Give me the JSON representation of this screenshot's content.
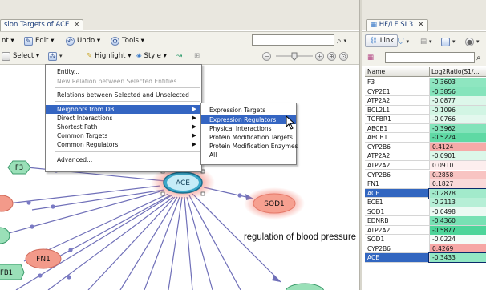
{
  "left_window": {
    "tab_title": "sion Targets of ACE",
    "toolbar1": {
      "items": [
        {
          "label": "nt ▾",
          "icon": "print-icon"
        },
        {
          "label": "Edit ▾",
          "icon": "edit-icon"
        },
        {
          "label": "Undo ▾",
          "icon": "undo-icon"
        },
        {
          "label": "Tools ▾",
          "icon": "tools-icon"
        }
      ]
    },
    "toolbar2": {
      "select_label": "Select ▾",
      "highlight_label": "Highlight ▾",
      "style_label": "Style ▾"
    },
    "context_menu": {
      "items": [
        {
          "label": "Entity...",
          "disabled": false,
          "submenu": false
        },
        {
          "label": "New Relation between Selected Entities...",
          "disabled": true,
          "submenu": false
        },
        {
          "label": "Relations between Selected and Unselected",
          "disabled": false,
          "submenu": false
        },
        {
          "label": "Neighbors from DB",
          "disabled": false,
          "submenu": true,
          "highlighted": true
        },
        {
          "label": "Direct Interactions",
          "disabled": false,
          "submenu": true
        },
        {
          "label": "Shortest Path",
          "disabled": false,
          "submenu": true
        },
        {
          "label": "Common Targets",
          "disabled": false,
          "submenu": true
        },
        {
          "label": "Common Regulators",
          "disabled": false,
          "submenu": true
        },
        {
          "label": "Advanced...",
          "disabled": false,
          "submenu": false
        }
      ]
    },
    "submenu": {
      "items": [
        {
          "label": "Expression Targets",
          "highlighted": false
        },
        {
          "label": "Expression Regulators",
          "highlighted": true
        },
        {
          "label": "Physical Interactions",
          "highlighted": false
        },
        {
          "label": "Protein Modification Targets",
          "highlighted": false
        },
        {
          "label": "Protein Modification Enzymes",
          "highlighted": false
        },
        {
          "label": "All",
          "highlighted": false
        }
      ]
    },
    "graph": {
      "nodes": [
        {
          "id": "ACE",
          "label": "ACE",
          "color": "#2a9ec0"
        },
        {
          "id": "SOD1",
          "label": "SOD1",
          "color": "#f39a8a"
        },
        {
          "id": "F3",
          "label": "F3",
          "color": "#9ae0b8"
        },
        {
          "id": "FN1",
          "label": "FN1",
          "color": "#f39a8a"
        },
        {
          "id": "FB1",
          "label": "FB1",
          "color": "#9ae0b8"
        }
      ],
      "process_label": "regulation of blood pressure"
    }
  },
  "right_window": {
    "tab_title": "HF/LF SI 3",
    "link_label": "Link",
    "columns": [
      "Name",
      "Log2Ratio(S1/..."
    ],
    "rows": [
      {
        "name": "F3",
        "value": "-0.3603",
        "color": "#8ee6c0"
      },
      {
        "name": "CYP2E1",
        "value": "-0.3856",
        "color": "#86e4bc"
      },
      {
        "name": "ATP2A2",
        "value": "-0.0877",
        "color": "#ddf7ea"
      },
      {
        "name": "BCL2L1",
        "value": "-0.1096",
        "color": "#d2f5e4"
      },
      {
        "name": "TGFBR1",
        "value": "-0.0766",
        "color": "#e3f8ee"
      },
      {
        "name": "ABCB1",
        "value": "-0.3962",
        "color": "#82e3ba"
      },
      {
        "name": "ABCB1",
        "value": "-0.5224",
        "color": "#5fd9a4"
      },
      {
        "name": "CYP2B6",
        "value": "0.4124",
        "color": "#f6aaa8"
      },
      {
        "name": "ATP2A2",
        "value": "-0.0901",
        "color": "#dcf7e9"
      },
      {
        "name": "ATP2A2",
        "value": "0.0910",
        "color": "#fdeeee"
      },
      {
        "name": "CYP2B6",
        "value": "0.2858",
        "color": "#f8c4c2"
      },
      {
        "name": "FN1",
        "value": "0.1827",
        "color": "#fadad9"
      },
      {
        "name": "ACE",
        "value": "-0.2878",
        "color": "#a2eacb",
        "selected": true
      },
      {
        "name": "ECE1",
        "value": "-0.2113",
        "color": "#b6efd6"
      },
      {
        "name": "SOD1",
        "value": "-0.0498",
        "color": "#ecfaf3"
      },
      {
        "name": "EDNRB",
        "value": "-0.4360",
        "color": "#78e1b4"
      },
      {
        "name": "ATP2A2",
        "value": "-0.5877",
        "color": "#4ed59a"
      },
      {
        "name": "SOD1",
        "value": "-0.0224",
        "color": "#f4fcf8"
      },
      {
        "name": "CYP2B6",
        "value": "0.4269",
        "color": "#f6a7a5"
      },
      {
        "name": "ACE",
        "value": "-0.3433",
        "color": "#92e7c3",
        "selected": true
      }
    ]
  }
}
